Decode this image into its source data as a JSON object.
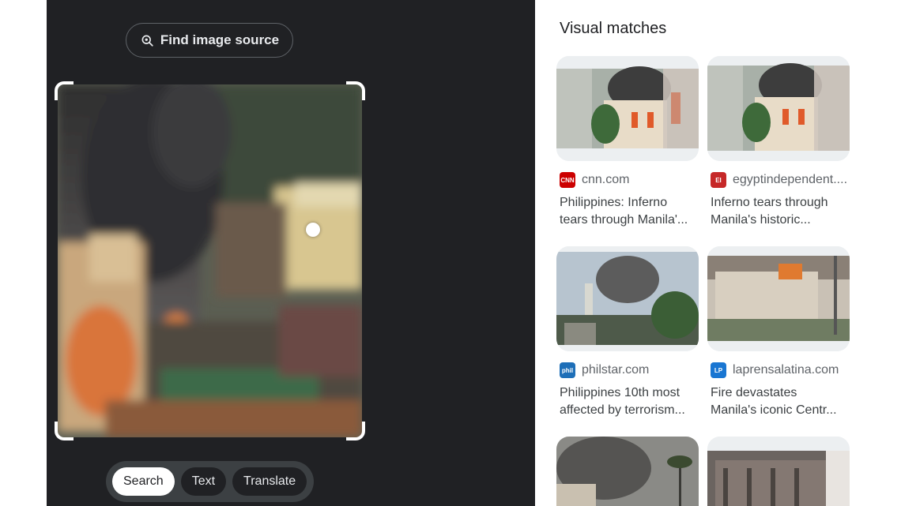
{
  "lens": {
    "find_source_label": "Find image source",
    "modes": [
      {
        "label": "Search",
        "active": true
      },
      {
        "label": "Text",
        "active": false
      },
      {
        "label": "Translate",
        "active": false
      }
    ]
  },
  "results": {
    "title": "Visual matches",
    "cards": [
      {
        "source": "cnn.com",
        "favicon_color": "#cc0000",
        "favicon_text": "CNN",
        "title_line1": "Philippines: Inferno",
        "title_line2": "tears through Manila'..."
      },
      {
        "source": "egyptindependent....",
        "favicon_color": "#c62828",
        "favicon_text": "EI",
        "title_line1": "Inferno tears through",
        "title_line2": "Manila's historic..."
      },
      {
        "source": "philstar.com",
        "favicon_color": "#1e6fb8",
        "favicon_text": "phil",
        "title_line1": "Philippines 10th most",
        "title_line2": "affected by terrorism..."
      },
      {
        "source": "laprensalatina.com",
        "favicon_color": "#1976d2",
        "favicon_text": "LP",
        "title_line1": "Fire devastates",
        "title_line2": "Manila's iconic Centr..."
      }
    ]
  }
}
